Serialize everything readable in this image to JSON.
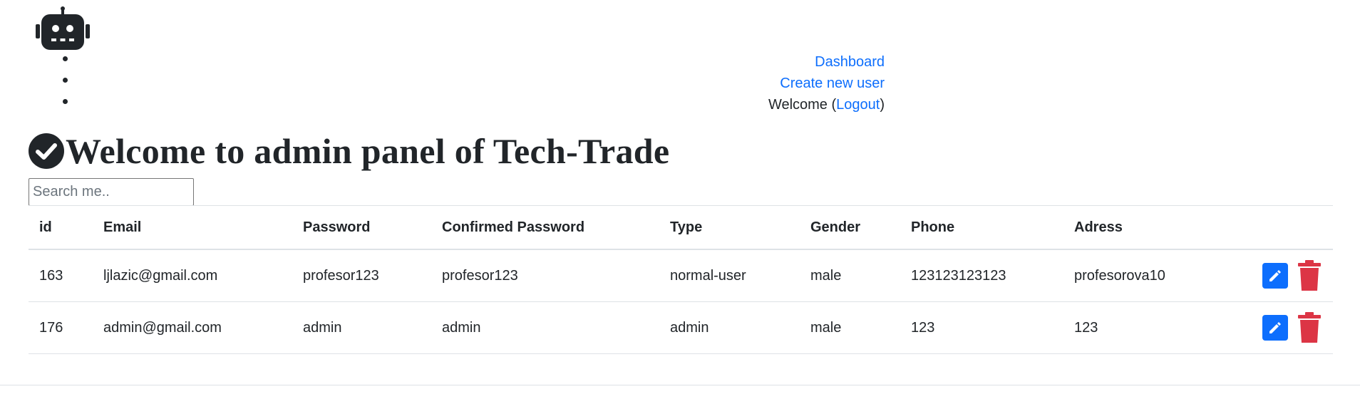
{
  "nav": {
    "dashboard_label": "Dashboard",
    "create_user_label": "Create new user",
    "welcome_text": "Welcome (",
    "logout_label": "Logout",
    "welcome_close": ")"
  },
  "header": {
    "title": "Welcome to admin panel of Tech-Trade"
  },
  "search": {
    "placeholder": "Search me..",
    "value": ""
  },
  "table": {
    "columns": [
      "id",
      "Email",
      "Password",
      "Confirmed Password",
      "Type",
      "Gender",
      "Phone",
      "Adress"
    ],
    "rows": [
      {
        "id": "163",
        "email": "ljlazic@gmail.com",
        "password": "profesor123",
        "confirmed_password": "profesor123",
        "type": "normal-user",
        "gender": "male",
        "phone": "123123123123",
        "adress": "profesorova10"
      },
      {
        "id": "176",
        "email": "admin@gmail.com",
        "password": "admin",
        "confirmed_password": "admin",
        "type": "admin",
        "gender": "male",
        "phone": "123",
        "adress": "123"
      }
    ]
  },
  "icons": {
    "logo": "robot-icon",
    "heading": "check-circle-icon",
    "edit": "pencil-icon",
    "delete": "trash-icon"
  },
  "colors": {
    "link": "#0d6efd",
    "edit_button": "#0d6efd",
    "delete_icon": "#dc3545",
    "text": "#212529"
  }
}
